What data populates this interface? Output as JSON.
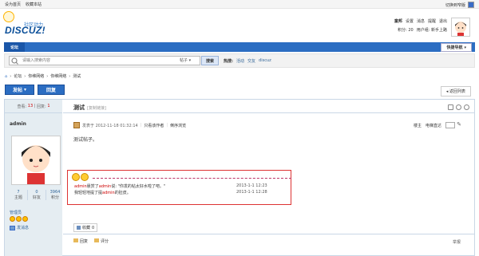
{
  "topbar": {
    "left_links": [
      "设为首页",
      "收藏本站"
    ],
    "right_link": "切换到窄版"
  },
  "logo": {
    "sub": "社区动力",
    "word": "DISCUZ!"
  },
  "usernav": {
    "row1": [
      "童邦",
      "设置",
      "消息",
      "提醒",
      "退出"
    ],
    "row2": [
      "积分: 20",
      "用户组: 新手上路"
    ]
  },
  "nav": {
    "forum": "论坛",
    "quicknav": "快捷导航"
  },
  "search": {
    "placeholder": "请输入搜索内容",
    "type": "帖子",
    "button": "搜索",
    "hot_label": "热搜:",
    "hot_words": [
      "活动",
      "交友",
      "discuz"
    ]
  },
  "breadcrumb": [
    "论坛",
    "你维网络",
    "你维网络",
    "测试"
  ],
  "buttons": {
    "post": "发帖",
    "reply": "回复",
    "back": "返回列表"
  },
  "thread": {
    "view_label": "查看:",
    "views": "13",
    "reply_label": "回复:",
    "replies": "1",
    "title": "测试",
    "copy_link": "[复制链接]"
  },
  "author": {
    "name": "admin",
    "stats": [
      {
        "value": "7",
        "label": "主题"
      },
      {
        "value": "0",
        "label": "好友"
      },
      {
        "value": "3964",
        "label": "积分"
      }
    ],
    "group": "管理员",
    "send_msg": "发消息"
  },
  "post": {
    "posted": "发表于 2012-11-18 01:32:14",
    "only_author": "只看该作者",
    "reverse": "倒序浏览",
    "floor": "楼主",
    "goto": "电梯直达",
    "content": "测试帖子。"
  },
  "notice": {
    "rows": [
      {
        "user": "admin",
        "text1": "悬赏了",
        "user2": "admin",
        "text2": "说: \"你发的帖太好水啦了吧。\"",
        "date": "2013-1-1 12:23"
      },
      {
        "prefix": "我轻轻地提了提",
        "user": "admin",
        "suffix": "的肚皮。",
        "date": "2013-1-1 12:28"
      }
    ]
  },
  "fav": {
    "label": "收藏",
    "count": "0"
  },
  "actions": {
    "reply": "回复",
    "rate": "评分",
    "report": "举报"
  }
}
